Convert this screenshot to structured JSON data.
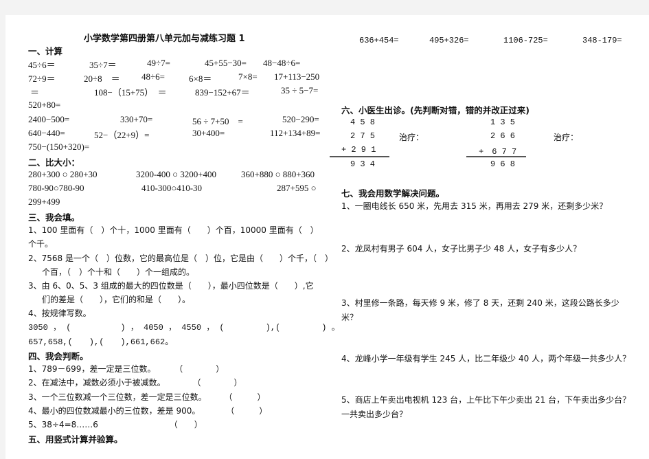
{
  "title": "小学数学第四册第八单元加与减练习题 1",
  "section1": {
    "heading": "一、计算",
    "row1": [
      "45÷6＝",
      "35÷7＝",
      "49÷7=",
      "45+55−30=",
      "48−48÷6="
    ],
    "row2": [
      "72÷9＝",
      "20÷8　＝",
      "48÷6=",
      "6×8＝",
      "7×8=",
      "17+113−250"
    ],
    "row3": [
      "＝",
      "108−（15+75）　＝",
      "839−152+67＝",
      "35 ÷ 5−7="
    ],
    "row4": [
      "520+80="
    ],
    "row5": [
      "2400−500=",
      "330+70=",
      "56 ÷ 7+50　=",
      "520−290="
    ],
    "row6": [
      "640−440=",
      "52−（22+9）=",
      "30+400=",
      "112+134+89="
    ],
    "row7": [
      "750−(150+320)="
    ]
  },
  "section2": {
    "heading": "二、比大小：",
    "circle": "○",
    "row1": [
      {
        "left": "280+300",
        "right": "280+30"
      },
      {
        "left": "3200-400",
        "right": "3200+400"
      },
      {
        "left": "360+880",
        "right": "880+360"
      }
    ],
    "row2": [
      {
        "left": "780-90",
        "right": "780-90"
      },
      {
        "left": "410-300",
        "right": "410-30"
      },
      {
        "left": "287+595",
        "right": ""
      }
    ],
    "row3": "299+499"
  },
  "section3": {
    "heading": "三、我会填。",
    "q1a": "1、100 里面有（　）个十，1000 里面有（　　）个百，10000 里面有（　）",
    "q1b": "个千。",
    "q2a": "2、7568 是一个（　）位数，它的最高位是（　）位，它是由（　　）个千，（　）",
    "q2b": "个百，（　）个十和（　　）个一组成的。",
    "q3a": "3、由 6、0、5、3 组成的最大的四位数是（　　），最小四位数是（　　）,它",
    "q3b": "们的差是（　　），它们的和是（　　）。",
    "q4": "4、按规律写数。",
    "seq1": "3050 ， (　　　　　　) ， 4050 ， 4550 ， (　　　　　),(　　　　　) 。",
    "seq2": "657,658,(　　),(　　),661,662。"
  },
  "section4": {
    "heading": "四、我会判断。",
    "items": [
      {
        "text": "1、789－699，差一定是三位数。",
        "paren": "（　　　　）"
      },
      {
        "text": "2、在减法中，减数必须小于被减数。",
        "paren": "（　　　　）"
      },
      {
        "text": "3、一个三位数减一个三位数，差一定是三位数。",
        "paren": "（　　　）"
      },
      {
        "text": "4、最小的四位数减最小的三位数，差是 900。",
        "paren": "（　　　）"
      },
      {
        "text": "5、38÷4=8……6",
        "paren": "（　　）"
      }
    ]
  },
  "section5": {
    "heading": "五、用竖式计算并验算。",
    "items": [
      "636+454=",
      "495+326=",
      "1106-725=",
      "348-179="
    ]
  },
  "section6": {
    "heading": "六、小医生出诊。(先判断对错，错的并改正过来)",
    "treat_label": "治疗：",
    "problems": [
      {
        "a": "4 5 8",
        "b": "2 7 5",
        "c": "+ 2 9 1",
        "result": "9 3 4"
      },
      {
        "a": "1 3 5",
        "b": "2 6 6",
        "c": "+　6 7 7",
        "result": "9 6 8"
      }
    ]
  },
  "section7": {
    "heading": "七、我会用数学解决问题。",
    "q1": "1、一圈电线长 650 米，先用去 315 米，再用去 279 米，还剩多少米？",
    "q2": "2、龙凤村有男子 604 人，女子比男子少 48 人，女子有多少人？",
    "q3a": "3、村里修一条路，每天修 9 米，修了 8 天，还剩 240 米，这段公路长多少",
    "q3b": "米？",
    "q4": "4、龙峰小学一年级有学生 245 人，比二年级少 40 人，两个年级一共多少人？",
    "q5a": "5、商店上午卖出电视机 123 台，上午比下午少卖出 21 台，下午卖出多少台？",
    "q5b": "一共卖出多少台？"
  }
}
